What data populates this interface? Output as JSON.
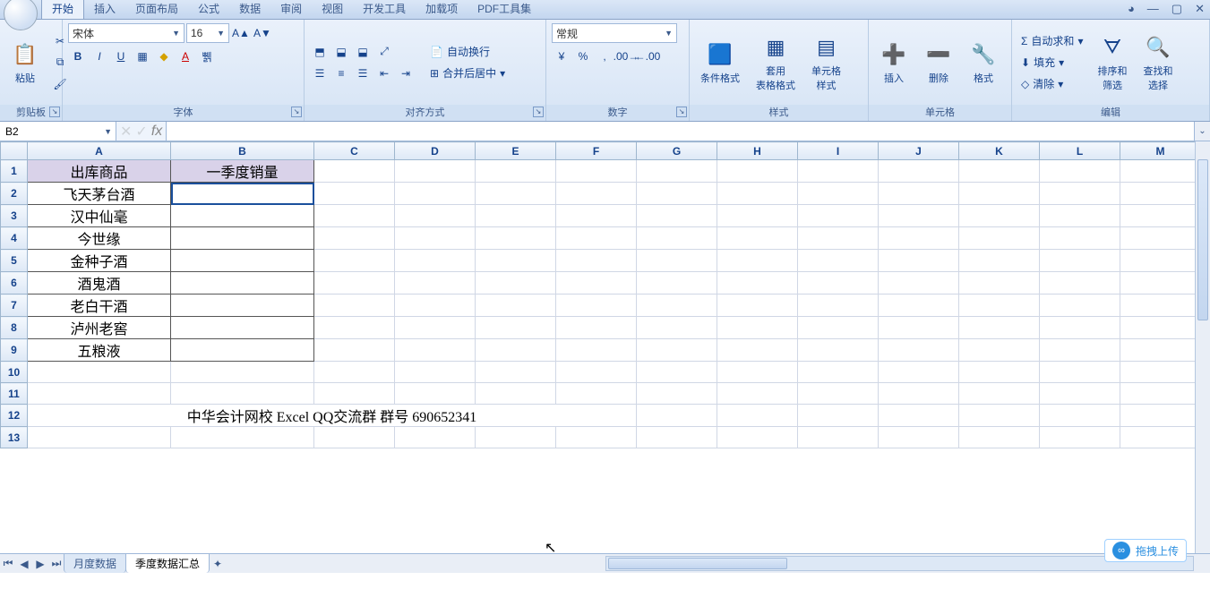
{
  "tabs": {
    "t0": "开始",
    "t1": "插入",
    "t2": "页面布局",
    "t3": "公式",
    "t4": "数据",
    "t5": "审阅",
    "t6": "视图",
    "t7": "开发工具",
    "t8": "加载项",
    "t9": "PDF工具集"
  },
  "ribbon": {
    "clipboard": {
      "paste": "粘贴",
      "title": "剪贴板"
    },
    "font": {
      "name": "宋体",
      "size": "16",
      "title": "字体"
    },
    "align": {
      "wrap": "自动换行",
      "merge": "合并后居中",
      "title": "对齐方式"
    },
    "number": {
      "format": "常规",
      "title": "数字"
    },
    "styles": {
      "cond": "条件格式",
      "tbl": "套用\n表格格式",
      "cell": "单元格\n样式",
      "title": "样式"
    },
    "cells": {
      "ins": "插入",
      "del": "删除",
      "fmt": "格式",
      "title": "单元格"
    },
    "editing": {
      "sum": "自动求和",
      "fill": "填充",
      "clear": "清除",
      "sort": "排序和\n筛选",
      "find": "查找和\n选择",
      "title": "编辑"
    }
  },
  "formula_bar": {
    "namebox": "B2",
    "fx": "fx",
    "value": ""
  },
  "columns": [
    "A",
    "B",
    "C",
    "D",
    "E",
    "F",
    "G",
    "H",
    "I",
    "J",
    "K",
    "L",
    "M"
  ],
  "rows": [
    "1",
    "2",
    "3",
    "4",
    "5",
    "6",
    "7",
    "8",
    "9",
    "10",
    "11",
    "12",
    "13"
  ],
  "table": {
    "hA": "出库商品",
    "hB": "一季度销量",
    "r2": "飞天茅台酒",
    "r3": "汉中仙毫",
    "r4": "今世缘",
    "r5": "金种子酒",
    "r6": "酒鬼酒",
    "r7": "老白干酒",
    "r8": "泸州老窖",
    "r9": "五粮液"
  },
  "footer_text": "中华会计网校 Excel QQ交流群 群号 690652341",
  "sheets": {
    "s1": "月度数据",
    "s2": "季度数据汇总"
  },
  "float": "拖拽上传"
}
